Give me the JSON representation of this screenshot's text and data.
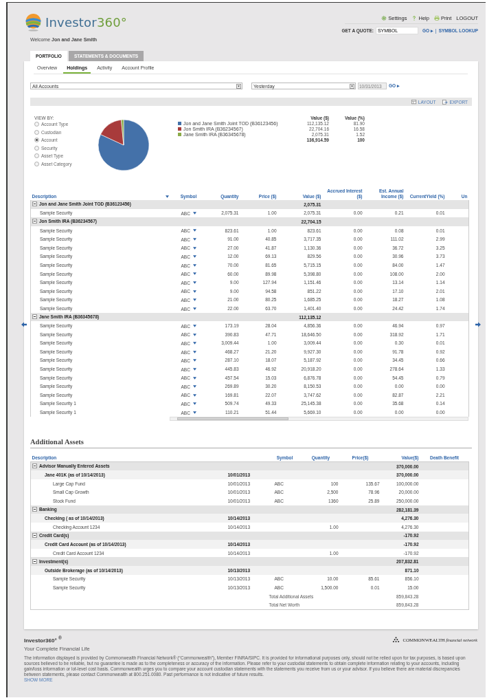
{
  "header": {
    "logo": {
      "name": "Investor",
      "suffix": "360°"
    },
    "welcome": "Welcome",
    "user_name": "Jon and Jane Smith",
    "top_links": [
      {
        "label": "Settings",
        "kind": "gear"
      },
      {
        "label": "Help",
        "kind": "help"
      },
      {
        "label": "Print",
        "kind": "print"
      },
      {
        "label": "LOGOUT",
        "kind": "plain"
      }
    ],
    "quote": {
      "label": "GET A QUOTE:",
      "value": "SYMBOL",
      "go": "GO ▸",
      "separator": "|",
      "lookup": "SYMBOL LOOKUP"
    }
  },
  "main_tabs": [
    {
      "label": "PORTFOLIO",
      "selected": true
    },
    {
      "label": "STATEMENTS & DOCUMENTS",
      "selected": false
    }
  ],
  "sub_tabs": [
    {
      "label": "Overview",
      "selected": false
    },
    {
      "label": "Holdings",
      "selected": true
    },
    {
      "label": "Activity",
      "selected": false
    },
    {
      "label": "Account Profile",
      "selected": false
    }
  ],
  "filters": {
    "account": "All Accounts",
    "period": "Yesterday",
    "date": "10/31/2013",
    "go": "GO ▸"
  },
  "toolbar": [
    {
      "label": "LAYOUT",
      "kind": "layout"
    },
    {
      "label": "EXPORT",
      "kind": "export"
    }
  ],
  "view_by": {
    "title": "VIEW BY:",
    "options": [
      {
        "label": "Account Type",
        "selected": false
      },
      {
        "label": "Custodian",
        "selected": false
      },
      {
        "label": "Account",
        "selected": true
      },
      {
        "label": "Security",
        "selected": false
      },
      {
        "label": "Asset Type",
        "selected": false
      },
      {
        "label": "Asset Category",
        "selected": false
      }
    ]
  },
  "allocation": {
    "headers": [
      "Value ($)",
      "Value (%)"
    ],
    "items": [
      {
        "name": "Jon and Jane Smith Joint TOD (B36123456)",
        "color": "#4471a9",
        "value": "112,135.12",
        "percent": "81.90"
      },
      {
        "name": "Jon Smith IRA (B36234567)",
        "color": "#a83b3b",
        "value": "22,704.16",
        "percent": "16.58"
      },
      {
        "name": "Jane Smith IRA (B36345678)",
        "color": "#8bab48",
        "value": "2,075.31",
        "percent": "1.52"
      }
    ],
    "total": {
      "value": "136,914.59",
      "percent": "100"
    },
    "chart_data": {
      "type": "pie",
      "values": [
        81.9,
        16.58,
        1.52
      ]
    }
  },
  "holdings": {
    "columns": [
      "Description",
      "Symbol",
      "Quantity",
      "Price ($)",
      "Value ($)",
      "Accrued Interest ($)",
      "Est. Annual Income ($)",
      "CurrentYield (%)",
      "Un"
    ],
    "groups": [
      {
        "name": "Jon and Jane Smith Joint TOD (B36123456)",
        "value": "2,075.31",
        "expanded": true,
        "rows": [
          [
            "Sample Security",
            "ABC",
            "2,075.31",
            "1.00",
            "2,075.31",
            "0.00",
            "0.21",
            "0.01"
          ]
        ]
      },
      {
        "name": "Jon Smith IRA (B36234567)",
        "value": "22,704.15",
        "expanded": true,
        "rows": [
          [
            "Sample Security",
            "ABC",
            "823.61",
            "1.00",
            "823.61",
            "0.00",
            "0.08",
            "0.01"
          ],
          [
            "Sample Security",
            "ABC",
            "91.00",
            "40.85",
            "3,717.35",
            "0.00",
            "111.02",
            "2.99"
          ],
          [
            "Sample Security",
            "ABC",
            "27.00",
            "41.87",
            "1,130.36",
            "0.00",
            "36.72",
            "3.25"
          ],
          [
            "Sample Security",
            "ABC",
            "12.00",
            "69.13",
            "829.56",
            "0.00",
            "30.96",
            "3.73"
          ],
          [
            "Sample Security",
            "ABC",
            "70.00",
            "81.65",
            "5,715.15",
            "0.00",
            "84.00",
            "1.47"
          ],
          [
            "Sample Security",
            "ABC",
            "60.00",
            "89.98",
            "5,398.80",
            "0.00",
            "108.00",
            "2.00"
          ],
          [
            "Sample Security",
            "ABC",
            "9.00",
            "127.94",
            "1,151.46",
            "0.00",
            "13.14",
            "1.14"
          ],
          [
            "Sample Security",
            "ABC",
            "9.00",
            "94.58",
            "851.22",
            "0.00",
            "17.10",
            "2.01"
          ],
          [
            "Sample Security",
            "ABC",
            "21.00",
            "80.25",
            "1,685.25",
            "0.00",
            "18.27",
            "1.08"
          ],
          [
            "Sample Security",
            "ABC",
            "22.00",
            "63.70",
            "1,401.40",
            "0.00",
            "24.42",
            "1.74"
          ]
        ]
      },
      {
        "name": "Jane Smith IRA (B36345678)",
        "value": "112,135.12",
        "expanded": true,
        "rows": [
          [
            "Sample Security",
            "ABC",
            "173.19",
            "28.04",
            "4,856.36",
            "0.00",
            "46.94",
            "0.97"
          ],
          [
            "Sample Security",
            "ABC",
            "390.83",
            "47.71",
            "18,646.50",
            "0.00",
            "318.92",
            "1.71"
          ],
          [
            "Sample Security",
            "ABC",
            "3,009.44",
            "1.00",
            "3,009.44",
            "0.00",
            "0.30",
            "0.01"
          ],
          [
            "Sample Security",
            "ABC",
            "468.27",
            "21.20",
            "9,927.30",
            "0.00",
            "91.78",
            "0.92"
          ],
          [
            "Sample Security",
            "ABC",
            "287.10",
            "18.07",
            "5,187.92",
            "0.00",
            "34.45",
            "0.66"
          ],
          [
            "Sample Security",
            "ABC",
            "445.83",
            "46.92",
            "20,918.20",
            "0.00",
            "278.64",
            "1.33"
          ],
          [
            "Sample Security",
            "ABC",
            "457.54",
            "15.03",
            "6,876.78",
            "0.00",
            "54.45",
            "0.79"
          ],
          [
            "Sample Security",
            "ABC",
            "269.89",
            "30.20",
            "8,150.53",
            "0.00",
            "0.00",
            "0.00"
          ],
          [
            "Sample Security",
            "ABC",
            "169.81",
            "22.07",
            "3,747.62",
            "0.00",
            "82.87",
            "2.21"
          ],
          [
            "Sample Security 1",
            "ABC",
            "509.74",
            "49.33",
            "25,145.38",
            "0.00",
            "35.68",
            "0.14"
          ],
          [
            "Sample Security 1",
            "ABC",
            "110.21",
            "51.44",
            "5,669.10",
            "0.00",
            "0.00",
            "0.00"
          ]
        ]
      }
    ]
  },
  "additional_assets": {
    "title": "Additional Assets",
    "columns": [
      "Description",
      "Symbol",
      "Quantity",
      "Price($)",
      "Value($)",
      "Death Benefit"
    ],
    "categories": [
      {
        "name": "Advisor Manually Entered Assets",
        "value": "370,000.00",
        "expanded": true,
        "children": [
          {
            "name": "Jane 401K (as of 10/14/2013)",
            "date": "10/01/2013",
            "value": "370,000.00",
            "children": [
              {
                "name": "Large Cap Fund",
                "date": "10/01/2013",
                "symbol": "ABC",
                "quantity": "100",
                "price": "135.67",
                "value": "100,000.00"
              },
              {
                "name": "Small Cap Growth",
                "date": "10/01/2013",
                "symbol": "ABC",
                "quantity": "2,500",
                "price": "78.96",
                "value": "20,000.00"
              },
              {
                "name": "Stock Fund",
                "date": "10/01/2013",
                "symbol": "ABC",
                "quantity": "1360",
                "price": "25.89",
                "value": "250,000.00"
              }
            ]
          }
        ]
      },
      {
        "name": "Banking",
        "value": "282,181.39",
        "expanded": true,
        "children": [
          {
            "name": "Checking ( as of 10/14/2013)",
            "date": "10/14/2013",
            "value": "4,276.30",
            "children": [
              {
                "name": "Checking Account 1234",
                "date": "10/14/2013",
                "quantity": "1.00",
                "value": "4,276.30"
              }
            ]
          }
        ]
      },
      {
        "name": "Credit Card(s)",
        "value": "-170.92",
        "expanded": true,
        "children": [
          {
            "name": "Credit Card Account (as of 10/14/2013)",
            "date": "10/14/2013",
            "value": "-170.92",
            "children": [
              {
                "name": "Credit Card Account 1234",
                "date": "10/14/2013",
                "quantity": "1.00",
                "value": "-170.92"
              }
            ]
          }
        ]
      },
      {
        "name": "Investment(s)",
        "value": "207,832.81",
        "expanded": true,
        "children": [
          {
            "name": "Outside Brokerage (as of 10/14/2013)",
            "date": "10/13/2013",
            "value": "871.10",
            "children": [
              {
                "name": "Sample Security",
                "date": "10/13/2013",
                "symbol": "ABC",
                "quantity": "10.00",
                "price": "85.61",
                "value": "856.10"
              },
              {
                "name": "Sample Security",
                "date": "10/13/2013",
                "symbol": "ABC",
                "quantity": "1,500.00",
                "price": "0.01",
                "value": "15.00"
              }
            ]
          }
        ]
      }
    ],
    "totals": [
      {
        "label": "Total Additional Assets",
        "value": "859,843.28"
      },
      {
        "label": "Total Net Worth",
        "value": "859,843.28"
      }
    ]
  },
  "footer": {
    "brand": "Investor360° $^{®}$",
    "tagline": "Your Complete Financial Life",
    "partner": {
      "name": "COMMONWEALTH",
      "suffix": "financial network"
    },
    "disclaimer": "The information displayed is provided by Commonwealth Financial Network® (“Commonwealth”), Member FINRA/SIPC. It is provided for informational purposes only, should not be relied upon for tax purposes, is based upon sources believed to be reliable, but no guarantee is made as to the completeness or accuracy of the information. Please refer to your custodial statements to obtain complete information relating to your accounts, including gain/loss information or lot-level cost basis. Commonwealth urges you to compare your account custodian statements with the statements you receive from us or your advisor. If you believe there are material discrepancies between statements, please contact Commonwealth at 800.251.0080. Past performance is not indicative of future results.",
    "show_more": "SHOW MORE"
  }
}
